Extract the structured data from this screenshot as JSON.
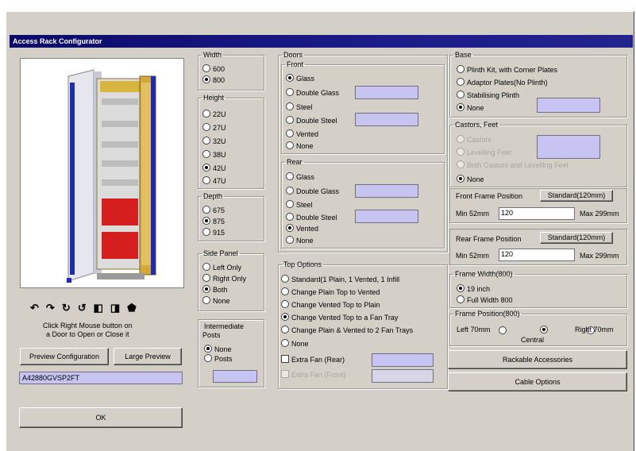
{
  "window": {
    "title": "Access Rack Configurator"
  },
  "preview": {
    "arrows": [
      "arrow-1",
      "arrow-2",
      "arrow-3",
      "arrow-4",
      "arrow-5",
      "arrow-6",
      "arrow-7"
    ],
    "hint_line1": "Click Right Mouse button on",
    "hint_line2": "a Door to Open or Close it",
    "preview_button": "Preview Configuration",
    "large_preview_button": "Large Preview",
    "part_code": "A42880GVSP2FT",
    "ok_button": "OK"
  },
  "width": {
    "legend": "Width",
    "options": [
      "600",
      "800"
    ],
    "selected": 1
  },
  "height": {
    "legend": "Height",
    "options": [
      "22U",
      "27U",
      "32U",
      "38U",
      "42U",
      "47U"
    ],
    "selected": 4
  },
  "depth": {
    "legend": "Depth",
    "options": [
      "675",
      "875",
      "915"
    ],
    "selected": 1
  },
  "side_panel": {
    "legend": "Side Panel",
    "options": [
      "Left Only",
      "Right Only",
      "Both",
      "None"
    ],
    "selected": 2
  },
  "intermediate_posts": {
    "legend_line1": "Intermediate",
    "legend_line2": "Posts",
    "options": [
      "None",
      "Posts"
    ],
    "selected": 0
  },
  "doors": {
    "legend": "Doors",
    "front": {
      "legend": "Front",
      "options": [
        "Glass",
        "Double Glass",
        "Steel",
        "Double Steel",
        "Vented",
        "None"
      ],
      "selected": 0
    },
    "rear": {
      "legend": "Rear",
      "options": [
        "Glass",
        "Double Glass",
        "Steel",
        "Double Steel",
        "Vented",
        "None"
      ],
      "selected": 4
    }
  },
  "top_options": {
    "legend": "Top Options",
    "options": [
      "Standard(1 Plain, 1 Vented, 1 Infill",
      "Change Plain Top to Vented",
      "Change Vented Top to Plain",
      "Change Vented Top to a Fan Tray",
      "Change Plain & Vented to 2 Fan Trays",
      "None"
    ],
    "selected": 3,
    "extra_fan": "Extra Fan (Rear)",
    "extra_fan_2": "Extra Fan (Front)"
  },
  "base": {
    "legend": "Base",
    "options": [
      "Plinth Kit, with Corner Plates",
      "Adaptor Plates(No Plinth)",
      "Stabilising Plinth",
      "None"
    ],
    "selected": 3
  },
  "castors": {
    "legend": "Castors, Feet",
    "options": [
      "Castors",
      "Levelling Feet",
      "Both Castors and Levelling Feet",
      "None"
    ],
    "selected": 3
  },
  "front_frame": {
    "label": "Front Frame Position",
    "button": "Standard(120mm)",
    "min_label": "Min 52mm",
    "value": "120",
    "max_label": "Max 299mm"
  },
  "rear_frame": {
    "label": "Rear Frame Position",
    "button": "Standard(120mm)",
    "min_label": "Min 52mm",
    "value": "120",
    "max_label": "Max 299mm"
  },
  "frame_width": {
    "legend": "Frame Width(800)",
    "options": [
      "19 inch",
      "Full Width 800"
    ],
    "selected": 0
  },
  "frame_position": {
    "legend": "Frame Position(800)",
    "left": "Left 70mm",
    "central": "Central",
    "right": "Right 70mm",
    "selected": 1
  },
  "buttons": {
    "rackable": "Rackable Accessories",
    "cable": "Cable Options"
  }
}
